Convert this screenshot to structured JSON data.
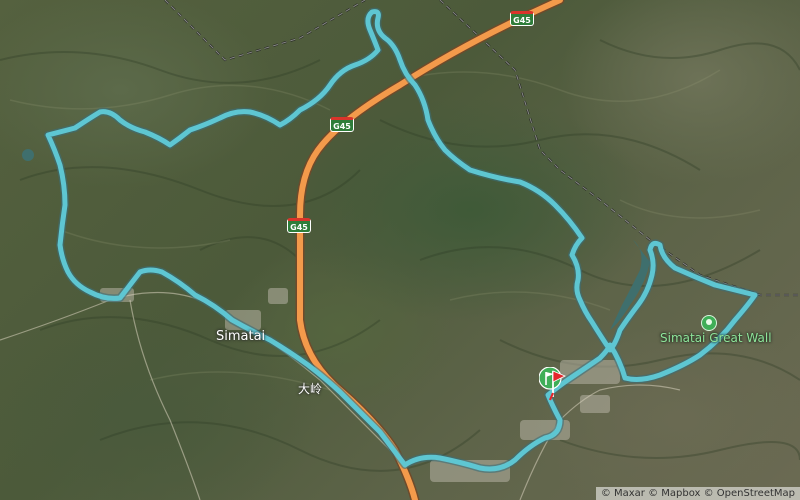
{
  "map": {
    "highway": {
      "shields": [
        "G45",
        "G45",
        "G45"
      ],
      "color": "#f39a4b"
    },
    "route_color": "#5ec6d2",
    "places": [
      {
        "name": "Simatai"
      },
      {
        "name": "大岭"
      }
    ],
    "poi": {
      "name": "Simatai Great Wall",
      "icon": "park-icon",
      "color": "#3fae57"
    },
    "markers": {
      "start_icon": "flag-icon",
      "start_color": "#3fae57",
      "end_color": "#e3262b"
    },
    "attribution": "© Maxar © Mapbox © OpenStreetMap"
  }
}
